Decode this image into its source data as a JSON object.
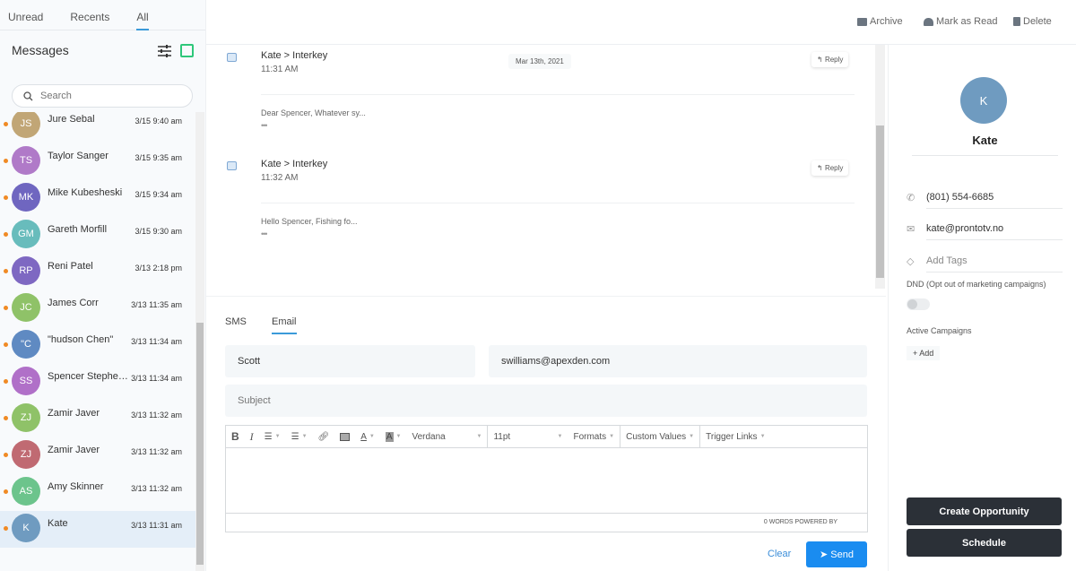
{
  "sidebar": {
    "tabs": [
      "Unread",
      "Recents",
      "All"
    ],
    "title": "Messages",
    "search_placeholder": "Search",
    "conversations": [
      {
        "initials": "JS",
        "name": "Jure Sebal",
        "time": "3/15 9:40 am",
        "color": "#c1a676"
      },
      {
        "initials": "TS",
        "name": "Taylor Sanger",
        "time": "3/15 9:35 am",
        "color": "#b07ac8"
      },
      {
        "initials": "MK",
        "name": "Mike Kubesheski",
        "time": "3/15 9:34 am",
        "color": "#6f66c0"
      },
      {
        "initials": "GM",
        "name": "Gareth Morfill",
        "time": "3/15 9:30 am",
        "color": "#68bcbc"
      },
      {
        "initials": "RP",
        "name": "Reni Patel",
        "time": "3/13 2:18 pm",
        "color": "#7e68c2"
      },
      {
        "initials": "JC",
        "name": "James Corr",
        "time": "3/13 11:35 am",
        "color": "#8fc268"
      },
      {
        "initials": "\"C",
        "name": "\"hudson Chen\"",
        "time": "3/13 11:34 am",
        "color": "#5f8ac2"
      },
      {
        "initials": "SS",
        "name": "Spencer Stephenson",
        "time": "3/13 11:34 am",
        "color": "#b070c8"
      },
      {
        "initials": "ZJ",
        "name": "Zamir Javer",
        "time": "3/13 11:32 am",
        "color": "#8fc268"
      },
      {
        "initials": "ZJ",
        "name": "Zamir Javer",
        "time": "3/13 11:32 am",
        "color": "#c06a72"
      },
      {
        "initials": "AS",
        "name": "Amy Skinner",
        "time": "3/13 11:32 am",
        "color": "#6cc48c"
      },
      {
        "initials": "K",
        "name": "Kate",
        "time": "3/13 11:31 am",
        "color": "#6f9bc0"
      }
    ]
  },
  "header": {
    "archive": "Archive",
    "mark_read": "Mark as Read",
    "delete": "Delete"
  },
  "thread": {
    "date": "Mar 13th, 2021",
    "messages": [
      {
        "from": "Kate > Interkey",
        "time": "11:31 AM",
        "snippet": "Dear Spencer, Whatever sy...",
        "reply": "Reply",
        "more": "•••"
      },
      {
        "from": "Kate > Interkey",
        "time": "11:32 AM",
        "snippet": "Hello Spencer, Fishing fo...",
        "reply": "Reply",
        "more": "•••"
      }
    ]
  },
  "composer": {
    "tabs": [
      "SMS",
      "Email"
    ],
    "from_name": "Scott",
    "from_email": "swilliams@apexden.com",
    "subject_placeholder": "Subject",
    "toolbar": {
      "bold": "B",
      "italic": "I",
      "font": "Verdana",
      "size": "11pt",
      "formats": "Formats",
      "custom_values": "Custom Values",
      "trigger_links": "Trigger Links"
    },
    "footer": "0 WORDS POWERED BY",
    "clear": "Clear",
    "send": "Send"
  },
  "contact": {
    "initial": "K",
    "name": "Kate",
    "phone": "(801) 554-6685",
    "email": "kate@prontotv.no",
    "tags_placeholder": "Add Tags",
    "dnd_label": "DND (Opt out of marketing campaigns)",
    "dnd_on": false,
    "campaigns_label": "Active Campaigns",
    "add": "+ Add",
    "create_opportunity": "Create Opportunity",
    "schedule": "Schedule"
  }
}
